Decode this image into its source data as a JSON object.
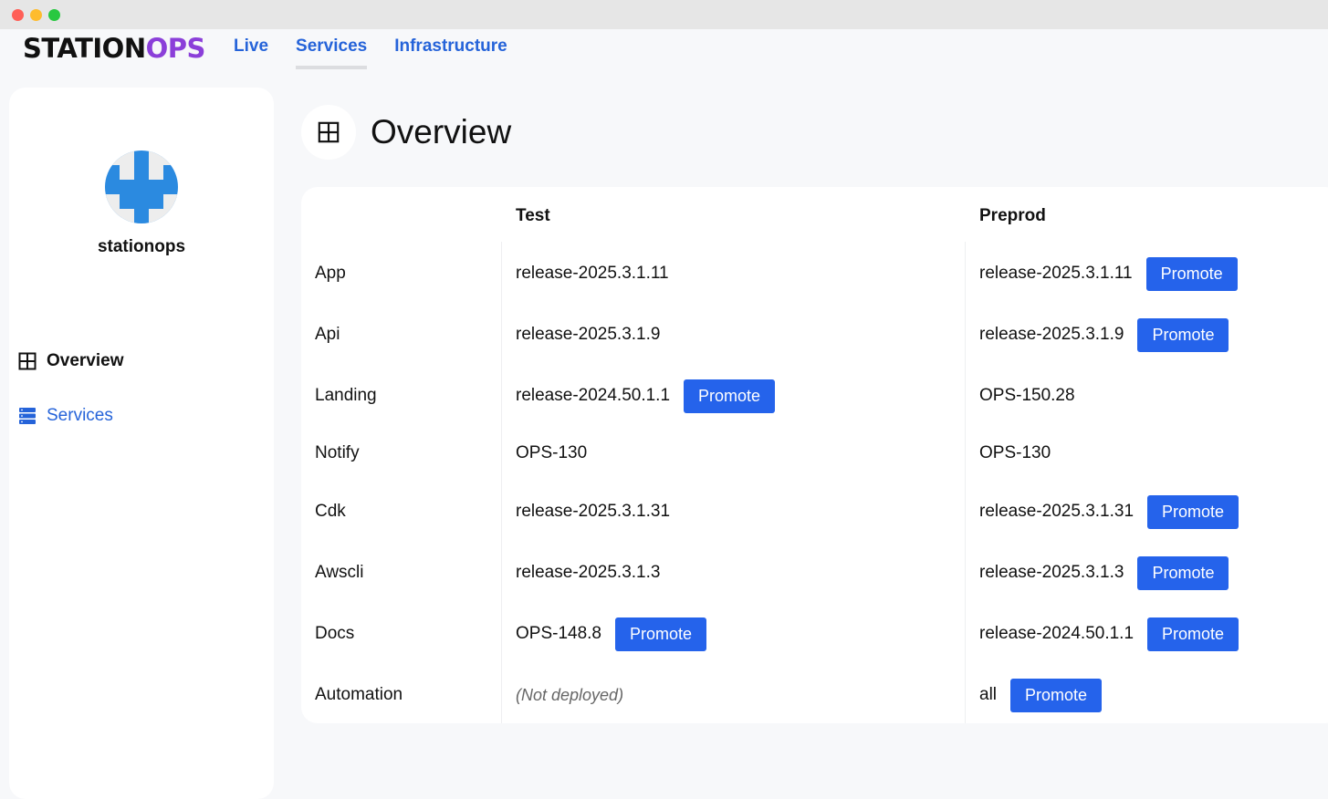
{
  "brand": {
    "name_main": "STATION",
    "name_accent": "OPS"
  },
  "topnav": [
    {
      "label": "Live",
      "active": false
    },
    {
      "label": "Services",
      "active": true
    },
    {
      "label": "Infrastructure",
      "active": false
    }
  ],
  "sidebar": {
    "org_name": "stationops",
    "items": [
      {
        "label": "Overview",
        "icon": "grid-icon",
        "active": true
      },
      {
        "label": "Services",
        "icon": "server-stack-icon",
        "active": false
      }
    ]
  },
  "page": {
    "title": "Overview",
    "icon": "grid-icon"
  },
  "table": {
    "columns": [
      "Test",
      "Preprod"
    ],
    "promote_label": "Promote",
    "rows": [
      {
        "name": "App",
        "test": "release-2025.3.1.11",
        "test_promote": false,
        "preprod": "release-2025.3.1.11",
        "preprod_promote": true
      },
      {
        "name": "Api",
        "test": "release-2025.3.1.9",
        "test_promote": false,
        "preprod": "release-2025.3.1.9",
        "preprod_promote": true
      },
      {
        "name": "Landing",
        "test": "release-2024.50.1.1",
        "test_promote": true,
        "preprod": "OPS-150.28",
        "preprod_promote": false
      },
      {
        "name": "Notify",
        "test": "OPS-130",
        "test_promote": false,
        "preprod": "OPS-130",
        "preprod_promote": false
      },
      {
        "name": "Cdk",
        "test": "release-2025.3.1.31",
        "test_promote": false,
        "preprod": "release-2025.3.1.31",
        "preprod_promote": true
      },
      {
        "name": "Awscli",
        "test": "release-2025.3.1.3",
        "test_promote": false,
        "preprod": "release-2025.3.1.3",
        "preprod_promote": true
      },
      {
        "name": "Docs",
        "test": "OPS-148.8",
        "test_promote": true,
        "preprod": "release-2024.50.1.1",
        "preprod_promote": true
      },
      {
        "name": "Automation",
        "test": "(Not deployed)",
        "test_promote": false,
        "preprod": "all",
        "preprod_promote": true
      }
    ]
  },
  "colors": {
    "accent": "#2563eb",
    "brand_accent": "#8b3fd9",
    "avatar": "#2b8ae0"
  }
}
